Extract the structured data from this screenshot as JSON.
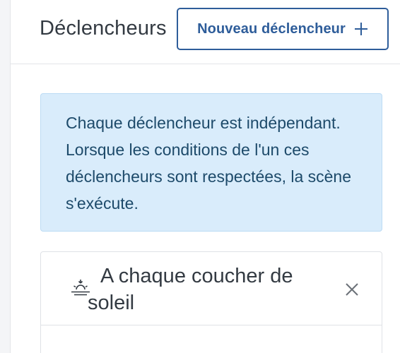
{
  "header": {
    "title": "Déclencheurs",
    "new_trigger_label": "Nouveau déclencheur"
  },
  "info": {
    "text": "Chaque déclencheur est indépendant. Lorsque les conditions de l'un ces déclencheurs sont respectées, la scène s'exécute."
  },
  "triggers": [
    {
      "title": "A chaque coucher de soleil",
      "icon": "sunset-icon"
    }
  ],
  "icons": {
    "add": "plus-icon",
    "remove": "close-icon"
  },
  "colors": {
    "accent": "#2e5d9a",
    "info_background": "#d9ecfb",
    "info_text": "#1d4a6a",
    "text": "#333a42",
    "border": "#dfe2e6"
  }
}
